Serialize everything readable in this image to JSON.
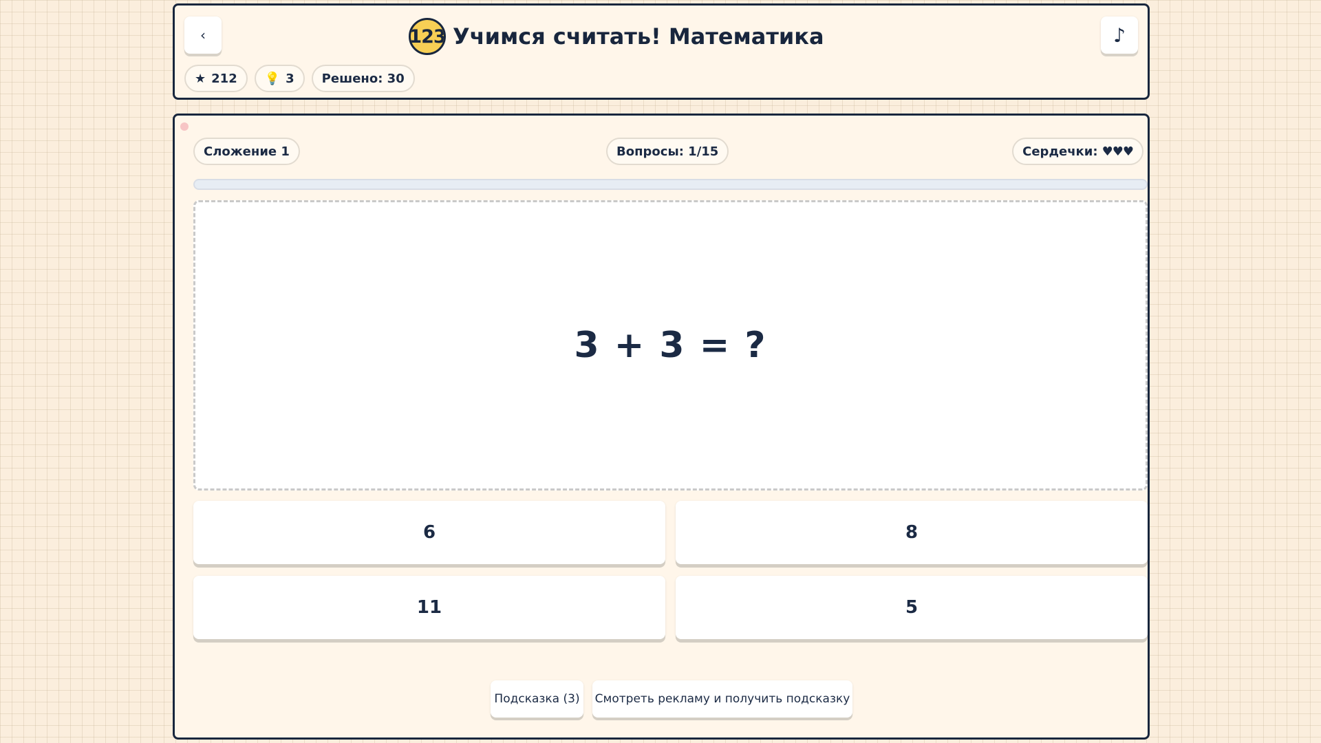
{
  "header": {
    "back_label": "‹",
    "music_label": "♪",
    "logo_text": "123",
    "title": "Учимся считать! Математика",
    "stats": {
      "stars_icon": "★",
      "stars": "212",
      "hints_icon": "💡",
      "hints": "3",
      "solved": "Решено: 30"
    }
  },
  "game": {
    "level": "Сложение 1",
    "questions": "Вопросы: 1/15",
    "hearts_label": "Сердечки:",
    "hearts": "♥♥♥",
    "progress": 0,
    "question": "3 + 3 = ?",
    "answers": [
      "6",
      "8",
      "11",
      "5"
    ],
    "hint_button": "Подсказка (3)",
    "ad_button": "Смотреть рекламу и получить подсказку"
  },
  "icons": {
    "back": "chevron-left-icon",
    "music": "music-note-icon",
    "star": "star-icon",
    "hint": "lightbulb-icon",
    "hearts": "heart-icon"
  },
  "colors": {
    "border": "#18263d",
    "logo": "#f7cf55",
    "panel": "#fff6ea",
    "background": "#fbeedd"
  }
}
